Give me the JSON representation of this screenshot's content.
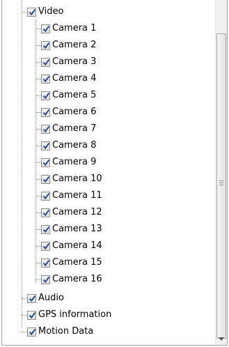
{
  "tree": {
    "video": {
      "label": "Video",
      "checked": true
    },
    "cameras": [
      {
        "label": "Camera 1",
        "checked": true
      },
      {
        "label": "Camera 2",
        "checked": true
      },
      {
        "label": "Camera 3",
        "checked": true
      },
      {
        "label": "Camera 4",
        "checked": true
      },
      {
        "label": "Camera 5",
        "checked": true
      },
      {
        "label": "Camera 6",
        "checked": true
      },
      {
        "label": "Camera 7",
        "checked": true
      },
      {
        "label": "Camera 8",
        "checked": true
      },
      {
        "label": "Camera 9",
        "checked": true
      },
      {
        "label": "Camera 10",
        "checked": true
      },
      {
        "label": "Camera 11",
        "checked": true
      },
      {
        "label": "Camera 12",
        "checked": true
      },
      {
        "label": "Camera 13",
        "checked": true
      },
      {
        "label": "Camera 14",
        "checked": true
      },
      {
        "label": "Camera 15",
        "checked": true
      },
      {
        "label": "Camera 16",
        "checked": true
      }
    ],
    "audio": {
      "label": "Audio",
      "checked": true
    },
    "gps": {
      "label": "GPS information",
      "checked": true
    },
    "motion": {
      "label": "Motion Data",
      "checked": true
    }
  },
  "icons": {
    "checkmark": "check-icon",
    "scroll_down": "arrow-down-icon"
  },
  "colors": {
    "checkmark": "#2b4c8c",
    "border": "#a0a0a0"
  }
}
